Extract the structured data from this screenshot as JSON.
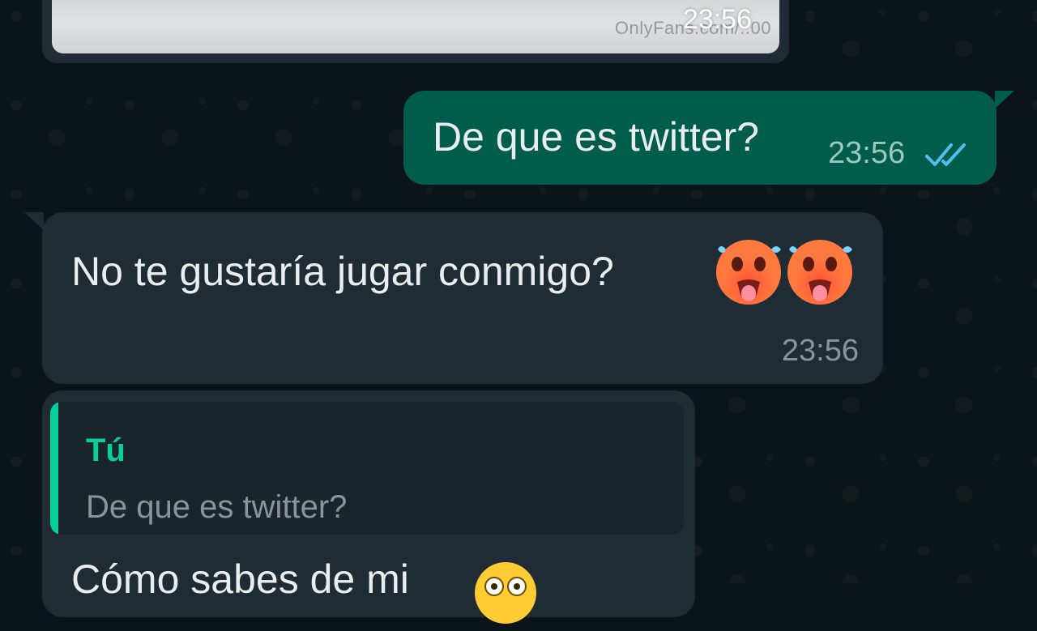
{
  "chat": {
    "image_message": {
      "watermark": "OnlyFans.com/..00",
      "time": "23:56"
    },
    "outgoing_message": {
      "text": "De que es twitter?",
      "time": "23:56",
      "status": "read"
    },
    "incoming_message_1": {
      "text": "No te gustaría jugar conmigo?",
      "emoji": [
        "hot-face-sweat",
        "hot-face-sweat"
      ],
      "time": "23:56"
    },
    "incoming_message_2": {
      "quote": {
        "author": "Tú",
        "text": "De que es twitter?"
      },
      "text": "Cómo sabes de mi",
      "emoji": "astonished-face"
    }
  },
  "colors": {
    "background": "#0b1418",
    "outgoing_bubble": "#005c4b",
    "incoming_bubble": "#1f2c33",
    "accent": "#06cf9c",
    "read_ticks": "#53bdeb"
  }
}
